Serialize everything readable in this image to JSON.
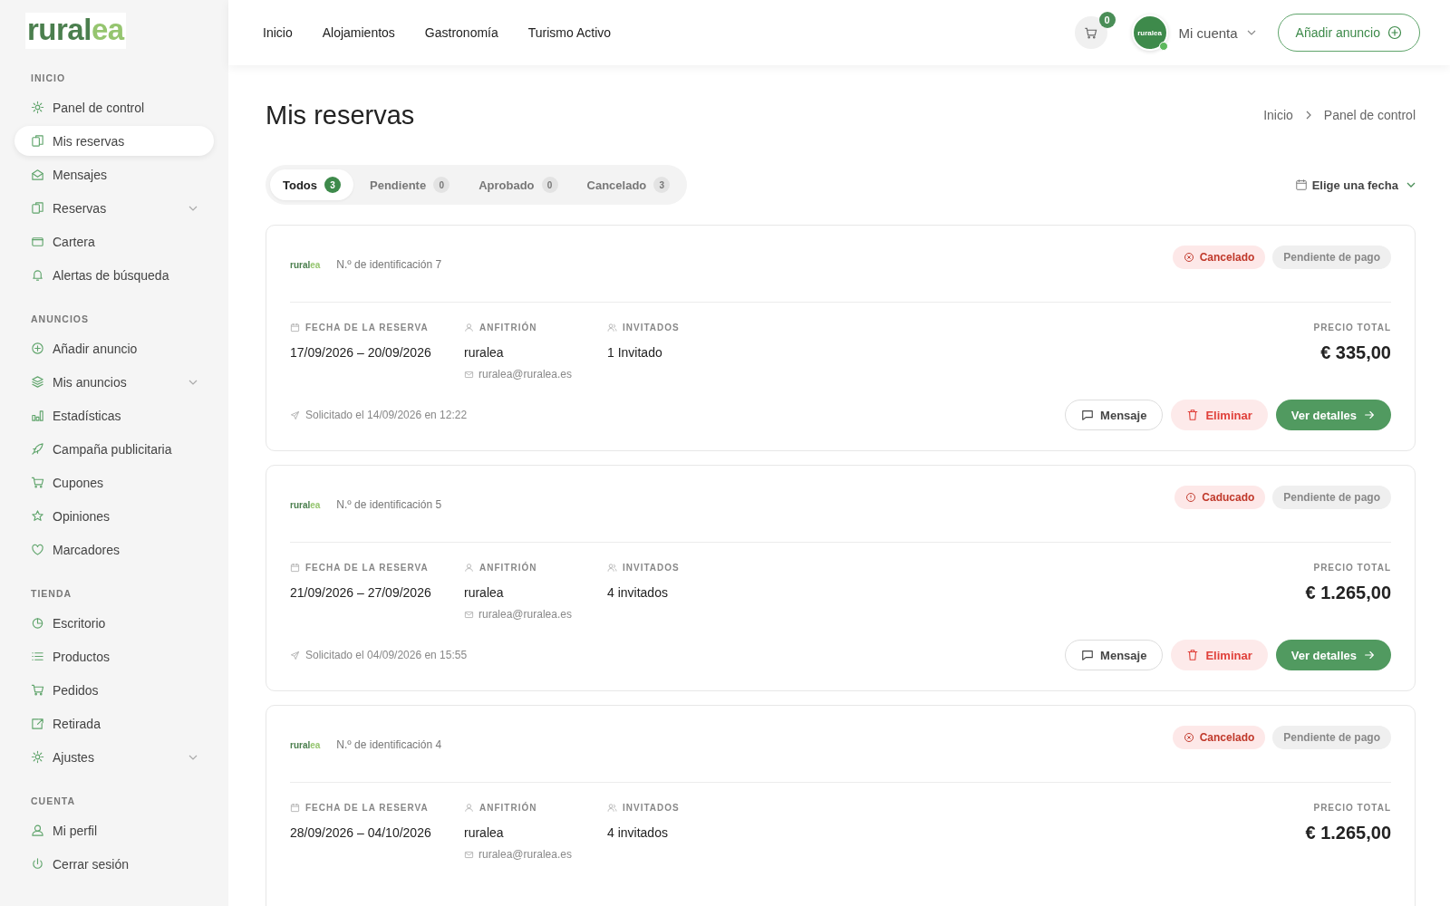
{
  "logo": {
    "main": "rural",
    "accent": "ea"
  },
  "sidebar": {
    "sections": [
      {
        "title": "INICIO",
        "items": [
          {
            "label": "Panel de control",
            "kind": "link",
            "selected": false
          },
          {
            "label": "Mis reservas",
            "kind": "link",
            "selected": true
          },
          {
            "label": "Mensajes",
            "kind": "link",
            "selected": false
          },
          {
            "label": "Reservas",
            "kind": "group",
            "selected": false
          },
          {
            "label": "Cartera",
            "kind": "link",
            "selected": false
          },
          {
            "label": "Alertas de búsqueda",
            "kind": "link",
            "selected": false
          }
        ]
      },
      {
        "title": "ANUNCIOS",
        "items": [
          {
            "label": "Añadir anuncio",
            "kind": "link",
            "selected": false
          },
          {
            "label": "Mis anuncios",
            "kind": "group",
            "selected": false
          },
          {
            "label": "Estadísticas",
            "kind": "link",
            "selected": false
          },
          {
            "label": "Campaña publicitaria",
            "kind": "link",
            "selected": false
          },
          {
            "label": "Cupones",
            "kind": "link",
            "selected": false
          },
          {
            "label": "Opiniones",
            "kind": "link",
            "selected": false
          },
          {
            "label": "Marcadores",
            "kind": "link",
            "selected": false
          }
        ]
      },
      {
        "title": "TIENDA",
        "items": [
          {
            "label": "Escritorio",
            "kind": "link",
            "selected": false
          },
          {
            "label": "Productos",
            "kind": "link",
            "selected": false
          },
          {
            "label": "Pedidos",
            "kind": "link",
            "selected": false
          },
          {
            "label": "Retirada",
            "kind": "link",
            "selected": false
          },
          {
            "label": "Ajustes",
            "kind": "group",
            "selected": false
          }
        ]
      },
      {
        "title": "CUENTA",
        "items": [
          {
            "label": "Mi perfil",
            "kind": "link",
            "selected": false
          },
          {
            "label": "Cerrar sesión",
            "kind": "link",
            "selected": false
          }
        ]
      }
    ]
  },
  "header": {
    "nav": [
      "Inicio",
      "Alojamientos",
      "Gastronomía",
      "Turismo Activo"
    ],
    "cart_count": "0",
    "avatar_text": "ruralea",
    "online": true,
    "account": "Mi cuenta",
    "add_button": "Añadir anuncio"
  },
  "page": {
    "title": "Mis reservas",
    "breadcrumb": [
      "Inicio",
      "Panel de control"
    ],
    "date_filter": "Elige una fecha"
  },
  "tabs": [
    {
      "label": "Todos",
      "count": "3",
      "selected": true
    },
    {
      "label": "Pendiente",
      "count": "0",
      "selected": false
    },
    {
      "label": "Aprobado",
      "count": "0",
      "selected": false
    },
    {
      "label": "Cancelado",
      "count": "3",
      "selected": false
    }
  ],
  "bookings": [
    {
      "logo": {
        "main": "rural",
        "accent": "ea"
      },
      "id_text": "N.º de identificación 7",
      "statuses": [
        {
          "kind": "cancelled",
          "label": "Cancelado"
        },
        {
          "kind": "payment",
          "label": "Pendiente de pago"
        }
      ],
      "date_label": "FECHA DE LA RESERVA",
      "date": "17/09/2026 – 20/09/2026",
      "host_label": "ANFITRIÓN",
      "host": "ruralea",
      "host_email": "ruralea@ruralea.es",
      "guests_label": "INVITADOS",
      "guests": "1 Invitado",
      "price_label": "PRECIO TOTAL",
      "price": "€ 335,00",
      "requested": "Solicitado el 14/09/2026 en 12:22",
      "actions": [
        {
          "kind": "message",
          "label": "Mensaje"
        },
        {
          "kind": "delete",
          "label": "Eliminar"
        },
        {
          "kind": "details",
          "label": "Ver detalles"
        }
      ]
    },
    {
      "logo": {
        "main": "rural",
        "accent": "ea"
      },
      "id_text": "N.º de identificación 5",
      "statuses": [
        {
          "kind": "expired",
          "label": "Caducado"
        },
        {
          "kind": "payment",
          "label": "Pendiente de pago"
        }
      ],
      "date_label": "FECHA DE LA RESERVA",
      "date": "21/09/2026 – 27/09/2026",
      "host_label": "ANFITRIÓN",
      "host": "ruralea",
      "host_email": "ruralea@ruralea.es",
      "guests_label": "INVITADOS",
      "guests": "4 invitados",
      "price_label": "PRECIO TOTAL",
      "price": "€ 1.265,00",
      "requested": "Solicitado el 04/09/2026 en 15:55",
      "actions": [
        {
          "kind": "message",
          "label": "Mensaje"
        },
        {
          "kind": "delete",
          "label": "Eliminar"
        },
        {
          "kind": "details",
          "label": "Ver detalles"
        }
      ]
    },
    {
      "logo": {
        "main": "rural",
        "accent": "ea"
      },
      "id_text": "N.º de identificación 4",
      "statuses": [
        {
          "kind": "cancelled",
          "label": "Cancelado"
        },
        {
          "kind": "payment",
          "label": "Pendiente de pago"
        }
      ],
      "date_label": "FECHA DE LA RESERVA",
      "date": "28/09/2026 – 04/10/2026",
      "host_label": "ANFITRIÓN",
      "host": "ruralea",
      "host_email": "ruralea@ruralea.es",
      "guests_label": "INVITADOS",
      "guests": "4 invitados",
      "price_label": "PRECIO TOTAL",
      "price": "€ 1.265,00"
    }
  ]
}
